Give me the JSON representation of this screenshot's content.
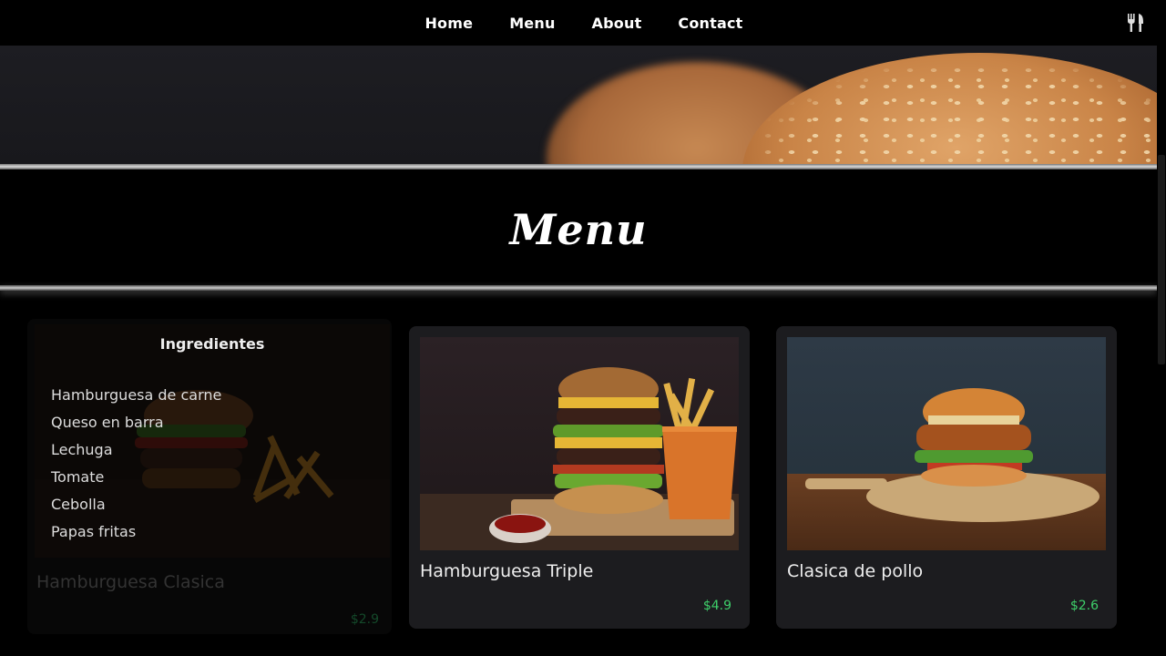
{
  "nav": {
    "items": [
      {
        "label": "Home"
      },
      {
        "label": "Menu"
      },
      {
        "label": "About"
      },
      {
        "label": "Contact"
      }
    ],
    "icon": "fork-knife-icon"
  },
  "page": {
    "title": "Menu"
  },
  "cards": [
    {
      "name": "Hamburguesa Clasica",
      "price": "$2.9",
      "ingredients_title": "Ingredientes",
      "ingredients": [
        "Hamburguesa de carne",
        "Queso en barra",
        "Lechuga",
        "Tomate",
        "Cebolla",
        "Papas fritas"
      ],
      "state": "hover"
    },
    {
      "name": "Hamburguesa Triple",
      "price": "$4.9"
    },
    {
      "name": "Clasica de pollo",
      "price": "$2.6"
    }
  ],
  "colors": {
    "background": "#000000",
    "card": "#1c1c1f",
    "price": "#3ecf6a"
  }
}
